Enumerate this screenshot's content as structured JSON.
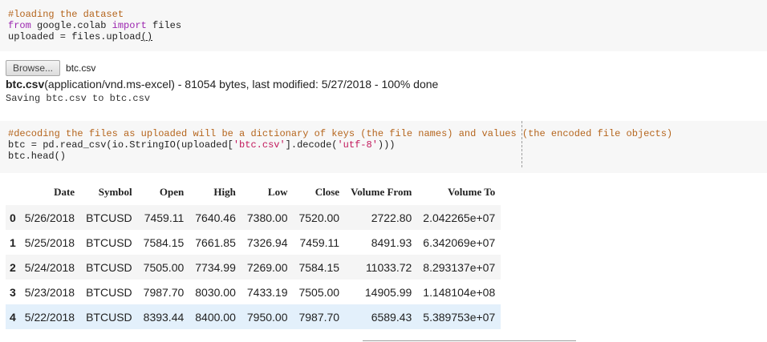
{
  "cell1": {
    "comment": "#loading the dataset",
    "line2": {
      "kw1": "from",
      "mod": " google.colab ",
      "kw2": "import",
      "rest": " files"
    },
    "line3": {
      "pre": "uploaded = files.upload",
      "paren": "()"
    }
  },
  "upload": {
    "browse_label": "Browse...",
    "file_name": "btc.csv",
    "info_name": "btc.csv",
    "info_rest": "(application/vnd.ms-excel) - 81054 bytes, last modified: 5/27/2018 - 100% done",
    "saving": "Saving btc.csv to btc.csv"
  },
  "cell2": {
    "comment": "#decoding the files as uploaded will be a dictionary of keys (the file names) and values (the encoded file objects)",
    "line2": {
      "pre": "btc = pd.read_csv(io.StringIO(uploaded[",
      "s1": "'btc.csv'",
      "mid": "].decode(",
      "s2": "'utf-8'",
      "post": ")))"
    },
    "line3": "btc.head()"
  },
  "table": {
    "columns": [
      "",
      "Date",
      "Symbol",
      "Open",
      "High",
      "Low",
      "Close",
      "Volume From",
      "Volume To"
    ],
    "rows": [
      [
        "0",
        "5/26/2018",
        "BTCUSD",
        "7459.11",
        "7640.46",
        "7380.00",
        "7520.00",
        "2722.80",
        "2.042265e+07"
      ],
      [
        "1",
        "5/25/2018",
        "BTCUSD",
        "7584.15",
        "7661.85",
        "7326.94",
        "7459.11",
        "8491.93",
        "6.342069e+07"
      ],
      [
        "2",
        "5/24/2018",
        "BTCUSD",
        "7505.00",
        "7734.99",
        "7269.00",
        "7584.15",
        "11033.72",
        "8.293137e+07"
      ],
      [
        "3",
        "5/23/2018",
        "BTCUSD",
        "7987.70",
        "8030.00",
        "7433.19",
        "7505.00",
        "14905.99",
        "1.148104e+08"
      ],
      [
        "4",
        "5/22/2018",
        "BTCUSD",
        "8393.44",
        "8400.00",
        "7950.00",
        "7987.70",
        "6589.43",
        "5.389753e+07"
      ]
    ]
  },
  "colors": {
    "comment": "#b5651d",
    "keyword": "#9c27b0",
    "string": "#c2185b",
    "cell_bg": "#f7f7f7",
    "highlight_row": "#e3f0fb"
  }
}
